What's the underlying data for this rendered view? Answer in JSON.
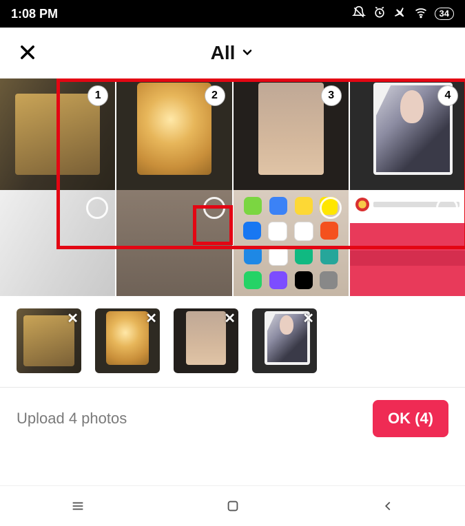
{
  "statusbar": {
    "time": "1:08 PM",
    "battery": "34"
  },
  "header": {
    "title": "All"
  },
  "gallery": {
    "row1": [
      {
        "selected_index": "1"
      },
      {
        "selected_index": "2"
      },
      {
        "selected_index": "3"
      },
      {
        "selected_index": "4"
      }
    ]
  },
  "selected_strip_count": 4,
  "footer": {
    "hint": "Upload 4 photos",
    "ok_label": "OK (4)"
  }
}
